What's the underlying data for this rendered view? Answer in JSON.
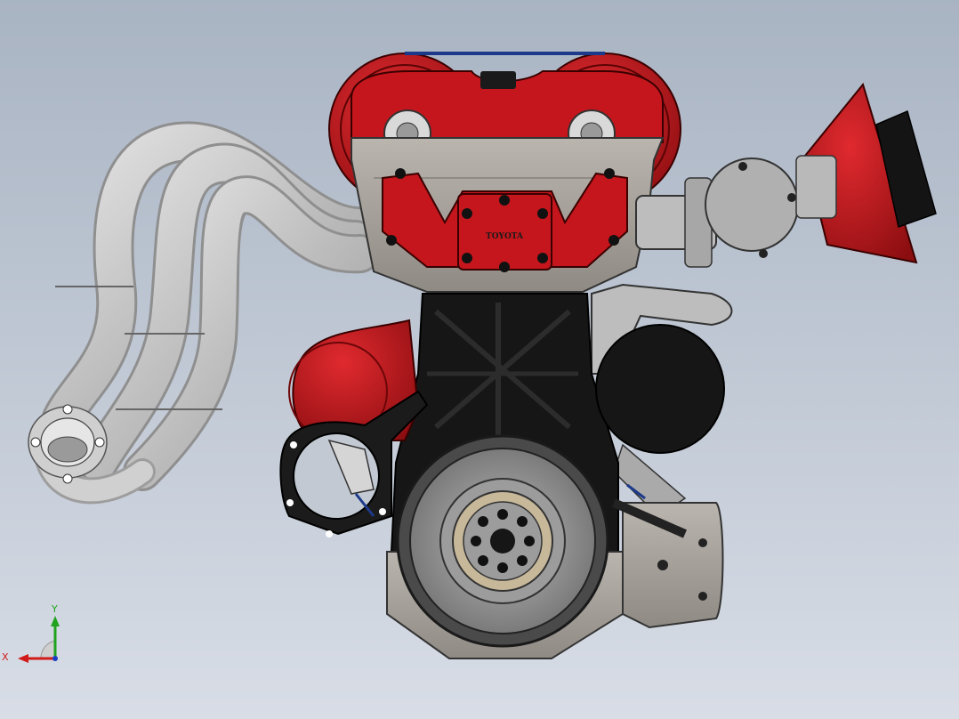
{
  "viewport": {
    "background_top": "#a9b4c3",
    "background_bottom": "#d8dde6"
  },
  "model": {
    "logo_text": "TOYOTA",
    "colors": {
      "red": "#c4161c",
      "dark_red": "#8a0d10",
      "block_black": "#161616",
      "aluminum": "#a8a39d",
      "header_pipe": "#c9c9c9",
      "belt_blue": "#1d3a8a"
    }
  },
  "triad": {
    "x_label": "X",
    "y_label": "Y",
    "x_color": "#d11a1a",
    "y_color": "#1fa31f",
    "z_color": "#1b3fc4"
  }
}
